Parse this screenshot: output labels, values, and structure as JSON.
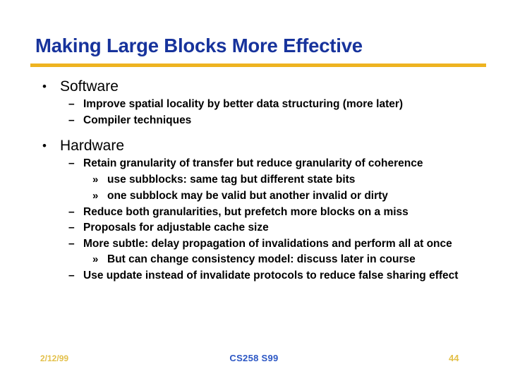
{
  "slide": {
    "title": "Making Large Blocks More Effective",
    "title_color": "#17339c",
    "rule_color": "#eeb320",
    "background": "#ffffff"
  },
  "markers": {
    "level1": "•",
    "level2": "–",
    "level3": "»"
  },
  "bullets": {
    "software_heading": "Software",
    "software_1": "Improve spatial locality by better data structuring (more later)",
    "software_2": "Compiler techniques",
    "hardware_heading": "Hardware",
    "hardware_1": "Retain granularity of transfer but reduce granularity of coherence",
    "hardware_1a": "use subblocks: same tag but different state bits",
    "hardware_1b": "one subblock may be valid but another invalid or dirty",
    "hardware_2": "Reduce both granularities, but prefetch more blocks on a miss",
    "hardware_3": "Proposals for adjustable cache size",
    "hardware_4": "More subtle: delay propagation of invalidations and perform all at once",
    "hardware_4a": "But can change consistency model: discuss later in course",
    "hardware_5": "Use update instead of invalidate protocols to reduce false sharing effect"
  },
  "footer": {
    "date": "2/12/99",
    "course": "CS258 S99",
    "page_number": "44",
    "date_color": "#e3c04a",
    "course_color": "#2b56c4",
    "page_color": "#e3c04a"
  }
}
